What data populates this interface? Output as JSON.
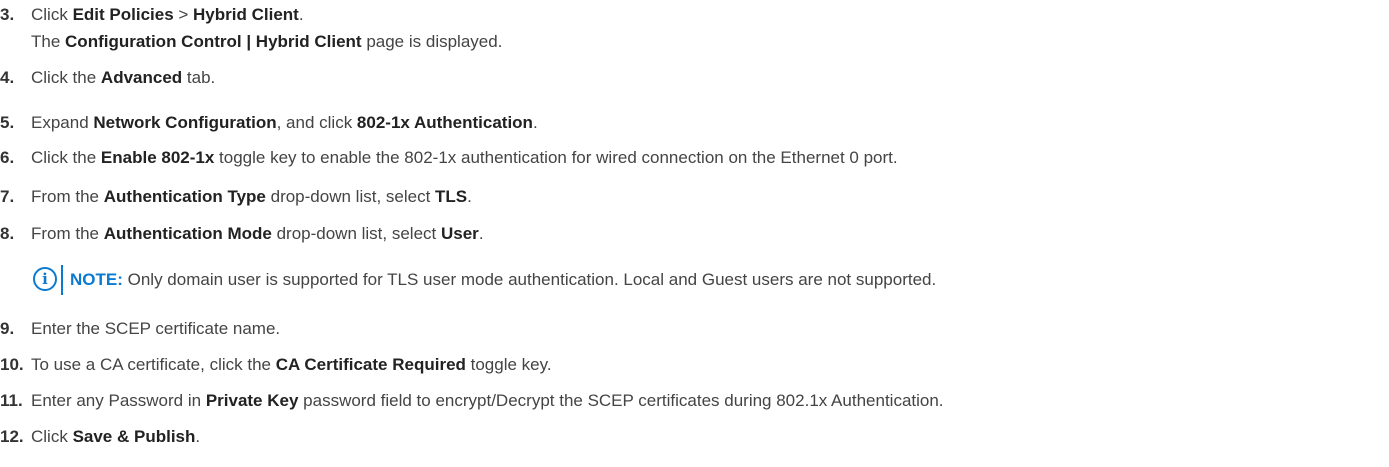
{
  "steps": [
    {
      "num": "3.",
      "parts": [
        {
          "t": "Click "
        },
        {
          "t": "Edit Policies",
          "b": true
        },
        {
          "t": " > "
        },
        {
          "t": "Hybrid Client",
          "b": true
        },
        {
          "t": "."
        }
      ]
    },
    {
      "num": "",
      "parts": [
        {
          "t": "The "
        },
        {
          "t": "Configuration Control | Hybrid Client",
          "b": true
        },
        {
          "t": " page is displayed."
        }
      ]
    },
    {
      "num": "4.",
      "parts": [
        {
          "t": "Click the "
        },
        {
          "t": "Advanced",
          "b": true
        },
        {
          "t": " tab."
        }
      ]
    },
    {
      "num": "5.",
      "parts": [
        {
          "t": "Expand "
        },
        {
          "t": "Network Configuration",
          "b": true
        },
        {
          "t": ", and click "
        },
        {
          "t": "802-1x Authentication",
          "b": true
        },
        {
          "t": "."
        }
      ]
    },
    {
      "num": "6.",
      "parts": [
        {
          "t": "Click the "
        },
        {
          "t": "Enable 802-1x",
          "b": true
        },
        {
          "t": " toggle key to enable the 802-1x authentication for wired connection on the Ethernet 0 port."
        }
      ]
    },
    {
      "num": "7.",
      "parts": [
        {
          "t": "From the "
        },
        {
          "t": "Authentication Type",
          "b": true
        },
        {
          "t": " drop-down list, select "
        },
        {
          "t": "TLS",
          "b": true
        },
        {
          "t": "."
        }
      ]
    },
    {
      "num": "8.",
      "parts": [
        {
          "t": "From the "
        },
        {
          "t": "Authentication Mode",
          "b": true
        },
        {
          "t": " drop-down list, select "
        },
        {
          "t": "User",
          "b": true
        },
        {
          "t": "."
        }
      ]
    },
    {
      "num": "9.",
      "parts": [
        {
          "t": "Enter the SCEP certificate name."
        }
      ]
    },
    {
      "num": "10.",
      "parts": [
        {
          "t": "To use a CA certificate, click the "
        },
        {
          "t": "CA Certificate Required",
          "b": true
        },
        {
          "t": " toggle key."
        }
      ]
    },
    {
      "num": "11.",
      "parts": [
        {
          "t": "Enter any Password in "
        },
        {
          "t": "Private Key",
          "b": true
        },
        {
          "t": " password field to encrypt/Decrypt the SCEP certificates during 802.1x Authentication."
        }
      ]
    },
    {
      "num": "12.",
      "parts": [
        {
          "t": "Click "
        },
        {
          "t": "Save & Publish",
          "b": true
        },
        {
          "t": "."
        }
      ]
    }
  ],
  "note": {
    "icon": "info-icon",
    "label": "NOTE:",
    "text": " Only domain user is supported for TLS user mode authentication. Local and Guest users are not supported."
  },
  "colors": {
    "note_accent": "#0b7ad1",
    "text": "#444444",
    "bold": "#222222"
  }
}
